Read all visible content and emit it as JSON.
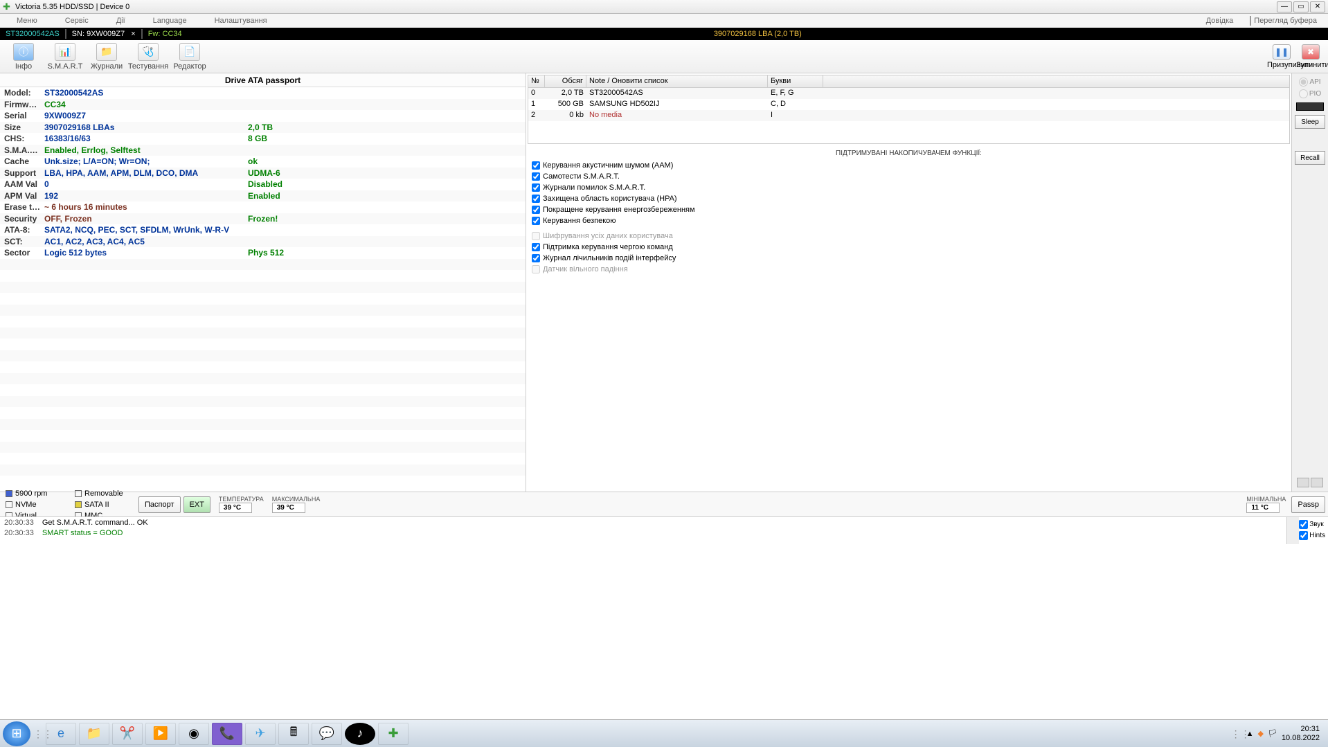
{
  "window": {
    "title": "Victoria 5.35 HDD/SSD | Device 0"
  },
  "menu": [
    "Меню",
    "Сервіс",
    "Дії",
    "Language",
    "Налаштування"
  ],
  "menu_right": {
    "help": "Довідка",
    "buffer": "Перегляд буфера"
  },
  "inforow": {
    "model": "ST32000542AS",
    "sn_label": "SN:",
    "sn": "9XW009Z7",
    "fw_label": "Fw:",
    "fw": "CC34",
    "lba": "3907029168 LBA (2,0 TB)"
  },
  "toolbar": {
    "info": "Інфо",
    "smart": "S.M.A.R.T",
    "logs": "Журнали",
    "test": "Тестування",
    "editor": "Редактор",
    "pause": "Призупинити",
    "stop": "Зупинити"
  },
  "passport": {
    "title": "Drive ATA passport",
    "rows": [
      {
        "label": "Model:",
        "v1": "ST32000542AS",
        "v2": ""
      },
      {
        "label": "Firmw…",
        "v1": "CC34",
        "v2": "",
        "c1": "green-v"
      },
      {
        "label": "Serial",
        "v1": "9XW009Z7",
        "v2": ""
      },
      {
        "label": "Size",
        "v1": "3907029168 LBAs",
        "v2": "2,0 TB"
      },
      {
        "label": "CHS:",
        "v1": "16383/16/63",
        "v2": "8 GB"
      },
      {
        "label": "S.M.A.…",
        "v1": "Enabled, Errlog, Selftest",
        "v2": "",
        "c1": "green-v"
      },
      {
        "label": "Cache",
        "v1": "Unk.size; L/A=ON; Wr=ON;",
        "v2": "ok"
      },
      {
        "label": "Support",
        "v1": "LBA, HPA, AAM, APM, DLM, DCO, DMA",
        "v2": "UDMA-6"
      },
      {
        "label": "AAM Val",
        "v1": "0",
        "v2": "Disabled"
      },
      {
        "label": "APM Val",
        "v1": "192",
        "v2": "Enabled"
      },
      {
        "label": "Erase t…",
        "v1": "~ 6 hours 16 minutes",
        "v2": "",
        "c1": "darkred"
      },
      {
        "label": "Security",
        "v1": "OFF, Frozen",
        "v2": "Frozen!",
        "c1": "darkred"
      },
      {
        "label": "ATA-8:",
        "v1": "SATA2, NCQ, PEC, SCT, SFDLM, WrUnk, W-R-V",
        "v2": ""
      },
      {
        "label": "SCT:",
        "v1": "AC1, AC2, AC3, AC4, AC5",
        "v2": ""
      },
      {
        "label": "Sector",
        "v1": "Logic 512 bytes",
        "v2": "Phys 512"
      }
    ]
  },
  "devlist": {
    "hdr": {
      "idx": "№",
      "size": "Обсяг",
      "note": "Note / Оновити список",
      "let": "Букви"
    },
    "rows": [
      {
        "idx": "0",
        "size": "2,0 TB",
        "note": "ST32000542AS",
        "let": "E, F, G"
      },
      {
        "idx": "1",
        "size": "500 GB",
        "note": "SAMSUNG HD502IJ",
        "let": "C, D"
      },
      {
        "idx": "2",
        "size": "0 kb",
        "note": "No media",
        "let": "I",
        "nm": true
      }
    ]
  },
  "features": {
    "title": "ПІДТРИМУВАНІ НАКОПИЧУВАЧЕМ ФУНКЦІЇ:",
    "items": [
      {
        "label": "Керування акустичним шумом (AAM)",
        "checked": true,
        "enabled": true
      },
      {
        "label": "Самотести S.M.A.R.T.",
        "checked": true,
        "enabled": true
      },
      {
        "label": "Журнали помилок S.M.A.R.T.",
        "checked": true,
        "enabled": true
      },
      {
        "label": "Захищена область користувача (HPA)",
        "checked": true,
        "enabled": true
      },
      {
        "label": "Покращене керування енергозбереженням",
        "checked": true,
        "enabled": true
      },
      {
        "label": "Керування безпекою",
        "checked": true,
        "enabled": true
      },
      {
        "label": "Шифрування усіх даних користувача",
        "checked": false,
        "enabled": false
      },
      {
        "label": "Підтримка керування чергою команд",
        "checked": true,
        "enabled": true
      },
      {
        "label": "Журнал лічильників подій інтерфейсу",
        "checked": true,
        "enabled": true
      },
      {
        "label": "Датчик вільного падіння",
        "checked": false,
        "enabled": false
      }
    ]
  },
  "sidebar": {
    "api": "API",
    "pio": "PIO",
    "sleep": "Sleep",
    "recall": "Recall",
    "passp": "Passp"
  },
  "bottom": {
    "rpm": "5900 rpm",
    "sata": "SATA II",
    "removable": "Removable",
    "virtual": "Virtual",
    "nvme": "NVMe",
    "mmc": "MMC",
    "passport_btn": "Паспорт",
    "ext_btn": "EXT"
  },
  "temps": {
    "cur_l": "ТЕМПЕРАТУРА",
    "cur_v": "39 °C",
    "max_l": "МАКСИМАЛЬНА",
    "max_v": "39 °C",
    "min_l": "МІНІМАЛЬНА",
    "min_v": "11 °C"
  },
  "log": [
    {
      "time": "20:30:33",
      "msg": "Get S.M.A.R.T. command... OK"
    },
    {
      "time": "20:30:33",
      "msg": "SMART status = GOOD",
      "cls": "lgreen"
    }
  ],
  "logtoggles": {
    "sound": "Звук",
    "hints": "Hints"
  },
  "taskbar": {
    "time": "20:31",
    "date": "10.08.2022"
  }
}
